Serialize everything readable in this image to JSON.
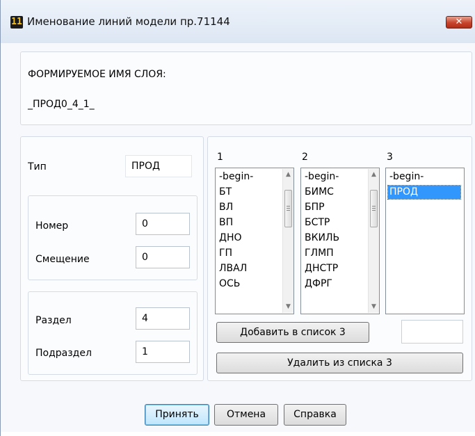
{
  "window": {
    "title": "Именование линий модели пр.71144",
    "app_icon_text": "11",
    "close_glyph": "✕"
  },
  "layer": {
    "heading": "ФОРМИРУЕМОЕ ИМЯ СЛОЯ:",
    "name": "_ПРОД0_4_1_"
  },
  "type": {
    "label": "Тип",
    "value": "ПРОД"
  },
  "number": {
    "label": "Номер",
    "value": "0"
  },
  "offset": {
    "label": "Смещение",
    "value": "0"
  },
  "section": {
    "label": "Раздел",
    "value": "4"
  },
  "subsection": {
    "label": "Подраздел",
    "value": "1"
  },
  "lists": [
    {
      "header": "1",
      "items": [
        "-begin-",
        "БТ",
        "ВЛ",
        "ВП",
        "ДНО",
        "ГП",
        "ЛВАЛ",
        "ОСЬ"
      ]
    },
    {
      "header": "2",
      "items": [
        "-begin-",
        "БИМС",
        "БПР",
        "БСТР",
        "ВКИЛЬ",
        "ГЛМП",
        "ДНСТР",
        "ДФРГ"
      ]
    },
    {
      "header": "3",
      "items": [
        "-begin-",
        "ПРОД"
      ],
      "selected_index": 1
    }
  ],
  "list3_input": {
    "value": ""
  },
  "buttons": {
    "add": "Добавить в список 3",
    "remove": "Удалить из списка 3",
    "accept": "Принять",
    "cancel": "Отмена",
    "help": "Справка"
  },
  "icons": {
    "scroll_up": "▲",
    "scroll_down": "▼"
  }
}
